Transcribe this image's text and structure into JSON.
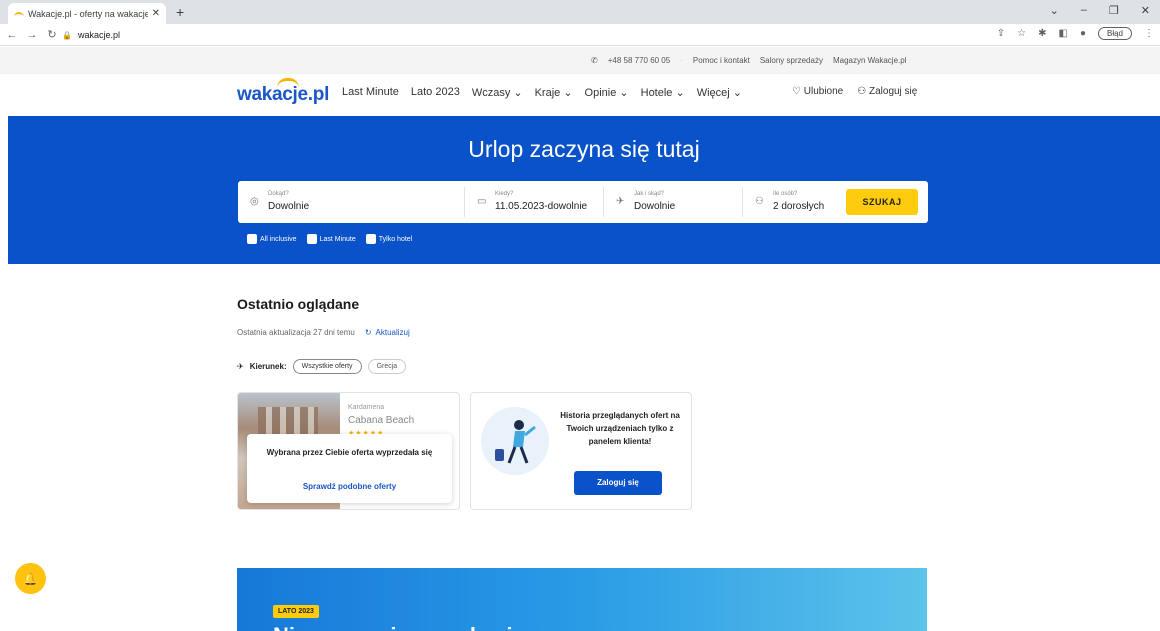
{
  "browser": {
    "tab_title": "Wakacje.pl - oferty na wakacje i",
    "url": "wakacje.pl",
    "profile_label": "Błąd"
  },
  "utility": {
    "phone": "+48 58 770 60 05",
    "items": [
      "Pomoc i kontakt",
      "Salony sprzedaży",
      "Magazyn Wakacje.pl"
    ]
  },
  "nav": {
    "logo": "wakacje.pl",
    "links": [
      "Last Minute",
      "Lato 2023",
      "Wczasy ⌄",
      "Kraje ⌄",
      "Opinie ⌄",
      "Hotele ⌄",
      "Więcej ⌄"
    ],
    "favorites": "Ulubione",
    "login": "Zaloguj się"
  },
  "hero": {
    "title": "Urlop zaczyna się tutaj",
    "fields": [
      {
        "label": "Dokąd?",
        "value": "Dowolnie"
      },
      {
        "label": "Kiedy?",
        "value": "11.05.2023-dowolnie"
      },
      {
        "label": "Jak i skąd?",
        "value": "Dowolnie"
      },
      {
        "label": "Ile osób?",
        "value": "2 dorosłych"
      }
    ],
    "search_button": "SZUKAJ",
    "checkboxes": [
      "All inclusive",
      "Last Minute",
      "Tylko hotel"
    ]
  },
  "recent": {
    "title": "Ostatnio oglądane",
    "updated": "Ostatnia aktualizacja 27 dni temu",
    "refresh": "Aktualizuj",
    "direction_label": "Kierunek:",
    "filters": [
      "Wszystkie oferty",
      "Grecja"
    ],
    "offer": {
      "place": "Kardamena",
      "hotel": "Cabana Beach",
      "stars": "★★★★★",
      "sold_out": "Wybrana przez Ciebie oferta wyprzedała się",
      "similar_link": "Sprawdź podobne oferty"
    },
    "history": {
      "text": "Historia przeglądanych ofert na Twoich urządzeniach tylko z panelem klienta!",
      "button": "Zaloguj się"
    }
  },
  "promo": {
    "badge": "LATO 2023",
    "headline": "Niezapomniane wakacje"
  },
  "colors": {
    "brand_blue": "#0a52c9",
    "accent_yellow": "#ffcc0d"
  }
}
